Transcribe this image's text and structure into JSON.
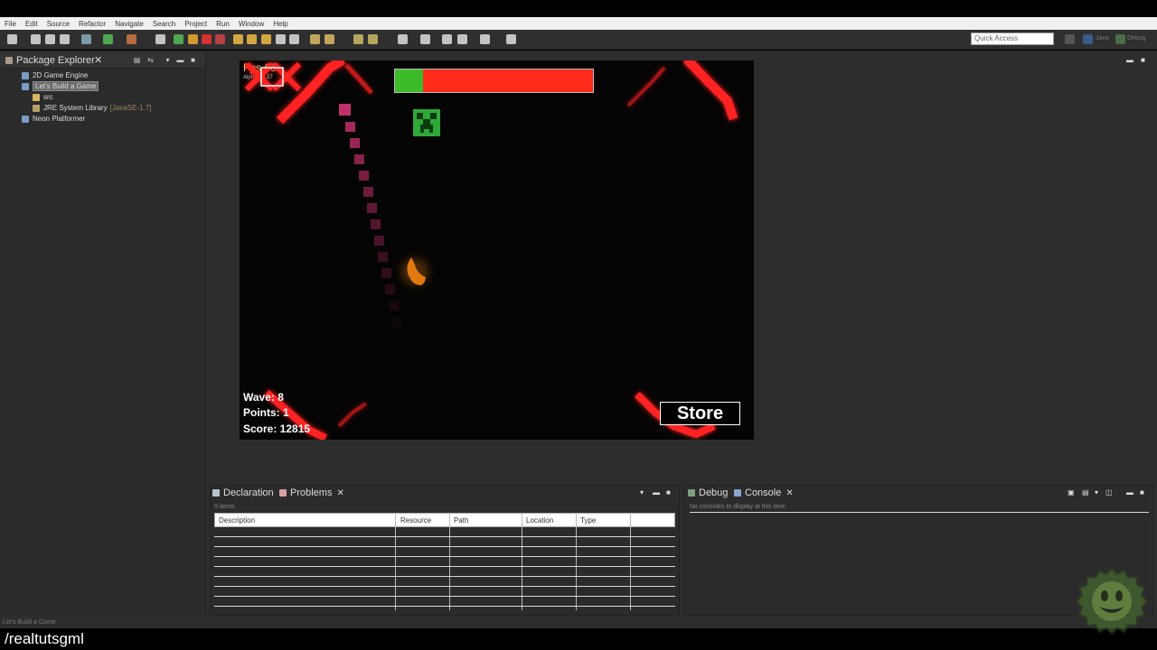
{
  "menubar": {
    "items": [
      "File",
      "Edit",
      "Source",
      "Refactor",
      "Navigate",
      "Search",
      "Project",
      "Run",
      "Window",
      "Help"
    ]
  },
  "toolbar": {
    "quick_access_placeholder": "Quick Access",
    "perspective_java": "Java",
    "perspective_debug": "Debug"
  },
  "package_explorer": {
    "title": "Package Explorer",
    "close": "✕",
    "tree": [
      {
        "label": "2D Game Engine",
        "level": 0,
        "icon": "project-folder-icon"
      },
      {
        "label": "Let's Build a Game",
        "level": 0,
        "selected": true,
        "icon": "project-folder-icon"
      },
      {
        "label": "src",
        "level": 1,
        "icon": "package-folder-icon"
      },
      {
        "label": "JRE System Library",
        "decoration": "[JavaSE-1.7]",
        "level": 1,
        "icon": "library-icon"
      },
      {
        "label": "Neon Platformer",
        "level": 0,
        "icon": "project-folder-icon"
      }
    ]
  },
  "game": {
    "fps": "Fps 60",
    "version": "Alpha V3.37",
    "health_fraction": 0.14,
    "wave": "Wave: 8",
    "points": "Points: 1",
    "score": "Score: 12815",
    "store": "Store",
    "colors": {
      "health_good": "#3dbb2a",
      "health_bad": "#ff2a1a",
      "enemy_red": "#ff2020",
      "trail_pink": "#c0306a",
      "player_orange": "#e07a10",
      "creeper_green": "#2ea836"
    }
  },
  "problems_panel": {
    "tab_declaration": "Declaration",
    "tab_problems": "Problems",
    "items_count": "0 items",
    "columns": [
      "Description",
      "Resource",
      "Path",
      "Location",
      "Type"
    ]
  },
  "console_panel": {
    "tab_debug": "Debug",
    "tab_console": "Console",
    "message": "No consoles to display at this time."
  },
  "statusbar": {
    "text": "Let's Build a Game"
  },
  "caption": {
    "text": "/realtutsgml"
  }
}
